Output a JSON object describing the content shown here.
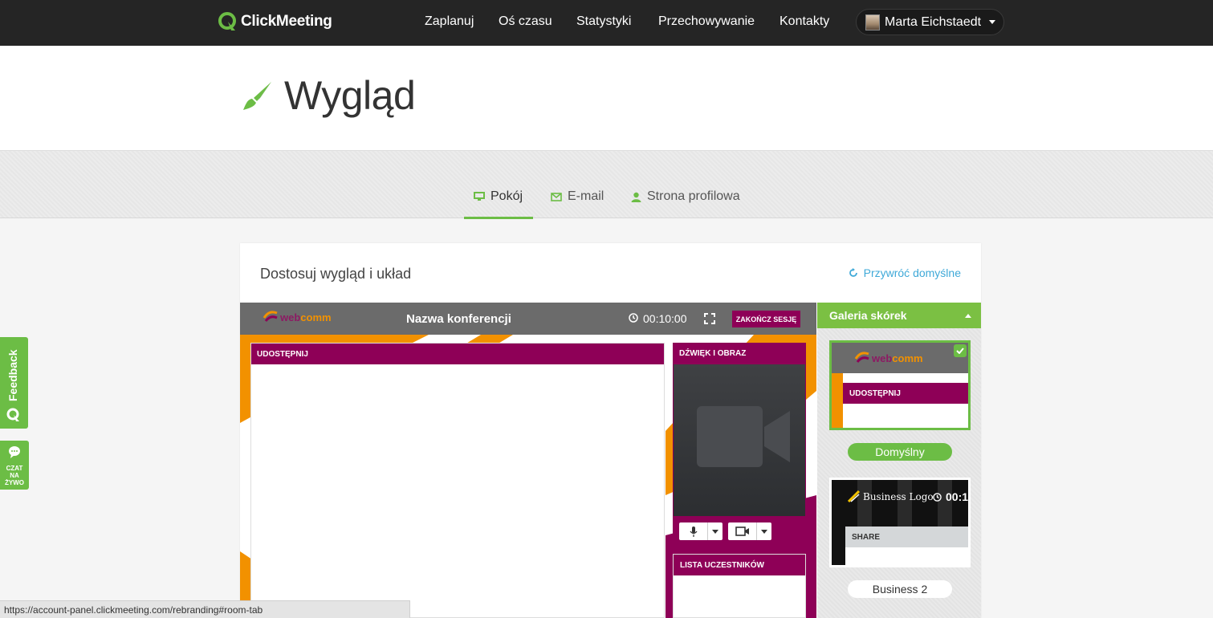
{
  "brand": {
    "name": "ClickMeeting"
  },
  "nav": {
    "items": [
      "Zaplanuj",
      "Oś czasu",
      "Statystyki",
      "Przechowywanie",
      "Kontakty"
    ]
  },
  "user": {
    "name": "Marta Eichstaedt"
  },
  "page": {
    "title": "Wygląd"
  },
  "tabs": [
    "Pokój",
    "E-mail",
    "Strona profilowa"
  ],
  "panel": {
    "title": "Dostosuj wygląd i układ",
    "reset_label": "Przywróć domyślne"
  },
  "preview": {
    "logo_prefix": "web",
    "logo_suffix": "comm",
    "conference_name": "Nazwa konferencji",
    "timer": "00:10:00",
    "end_session": "ZAKOŃCZ SESJĘ",
    "share_title": "UDOSTĘPNIJ",
    "av_title": "DŹWIĘK I OBRAZ",
    "participants_title": "LISTA UCZESTNIKÓW"
  },
  "gallery": {
    "title": "Galeria skórek",
    "skins": [
      {
        "name": "Domyślny",
        "preview_logo_prefix": "web",
        "preview_logo_suffix": "comm",
        "preview_share": "UDOSTĘPNIJ",
        "selected": true
      },
      {
        "name": "Business 2",
        "preview_logo": "Business Logo",
        "preview_timer": "00:1",
        "preview_share": "SHARE",
        "selected": false
      }
    ]
  },
  "side": {
    "feedback": "Feedback",
    "chat": [
      "CZAT",
      "NA",
      "ŻYWO"
    ]
  },
  "status_url": "https://account-panel.clickmeeting.com/rebranding#room-tab",
  "colors": {
    "accent_green": "#6cbd45",
    "webcomm_magenta": "#8e0057",
    "webcomm_orange": "#f29100",
    "link_blue": "#3fa9d8",
    "topbar": "#252525"
  }
}
